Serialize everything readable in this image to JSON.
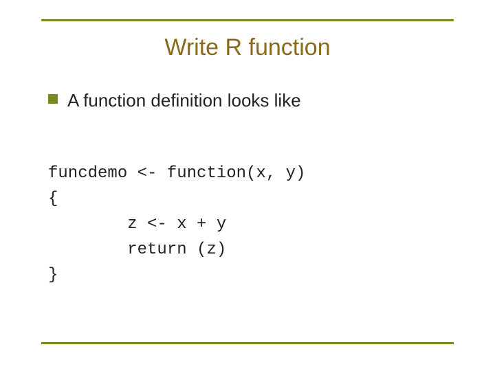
{
  "title": "Write R function",
  "bullets": [
    {
      "text": "A function  definition looks like"
    }
  ],
  "code": {
    "line1": "funcdemo <- function(x, y)",
    "line2": "{",
    "line3": "        z <- x + y",
    "line4": "        return (z)",
    "line5": "}"
  },
  "colors": {
    "accent": "#7a8a1f",
    "title": "#8a6a1a"
  }
}
